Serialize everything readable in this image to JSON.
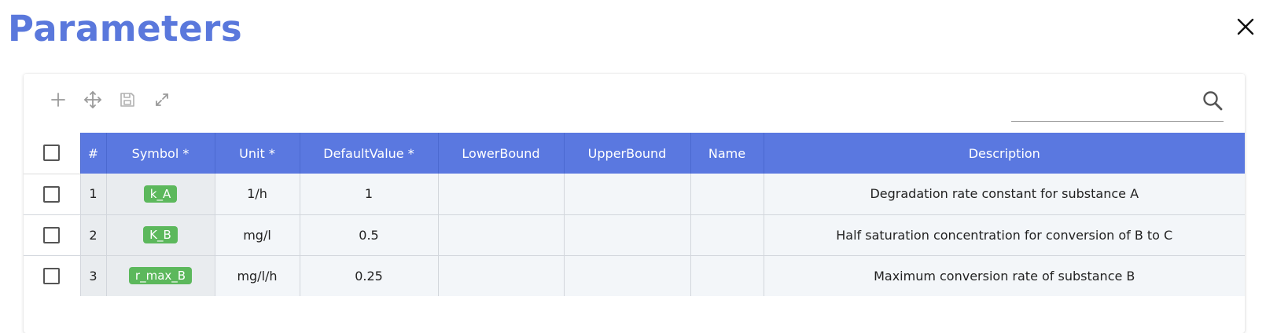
{
  "page": {
    "title": "Parameters",
    "close_icon": "close-icon"
  },
  "toolbar": {
    "add_icon": "plus-icon",
    "move_icon": "move-arrows-icon",
    "save_icon": "save-icon",
    "expand_icon": "expand-icon",
    "search_icon": "search-icon",
    "search_value": ""
  },
  "table": {
    "headers": {
      "num": "#",
      "symbol": "Symbol *",
      "unit": "Unit *",
      "default": "DefaultValue *",
      "lower": "LowerBound",
      "upper": "UpperBound",
      "name": "Name",
      "description": "Description"
    },
    "rows": [
      {
        "num": "1",
        "symbol": "k_A",
        "unit": "1/h",
        "default": "1",
        "lower": "",
        "upper": "",
        "name": "",
        "description": "Degradation rate constant for substance A"
      },
      {
        "num": "2",
        "symbol": "K_B",
        "unit": "mg/l",
        "default": "0.5",
        "lower": "",
        "upper": "",
        "name": "",
        "description": "Half saturation concentration for conversion of B to C"
      },
      {
        "num": "3",
        "symbol": "r_max_B",
        "unit": "mg/l/h",
        "default": "0.25",
        "lower": "",
        "upper": "",
        "name": "",
        "description": "Maximum conversion rate of substance B"
      }
    ]
  },
  "colors": {
    "title": "#5a78dc",
    "header_bg": "#5a78e0",
    "badge": "#5cb85c",
    "row_bg": "#f3f6f9"
  }
}
